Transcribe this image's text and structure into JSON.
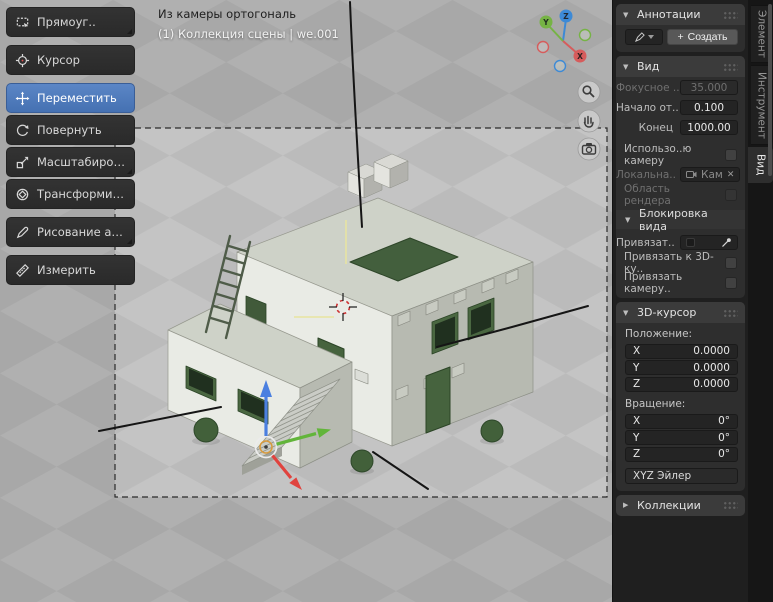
{
  "ui": {
    "tri_open": "▼",
    "tri_closed": "▶",
    "plus": "+",
    "clear": "✕"
  },
  "toolbar": {
    "tools": [
      {
        "label": "Прямоуг..",
        "active": false,
        "has_subtools": true
      },
      {
        "label": "Курсор",
        "active": false,
        "has_subtools": false
      },
      {
        "label": "Переместить",
        "active": true,
        "has_subtools": false
      },
      {
        "label": "Повернуть",
        "active": false,
        "has_subtools": false
      },
      {
        "label": "Масштабировать",
        "active": false,
        "has_subtools": true
      },
      {
        "label": "Трансформиров..",
        "active": false,
        "has_subtools": false
      },
      {
        "label": "Рисование анно..",
        "active": false,
        "has_subtools": true
      },
      {
        "label": "Измерить",
        "active": false,
        "has_subtools": false
      }
    ]
  },
  "viewport": {
    "view_label": "Из камеры ортогональ",
    "scene_label": "(1) Коллекция сцены | we.001",
    "axes": {
      "x": "X",
      "y": "Y",
      "z": "Z"
    }
  },
  "sidebar": {
    "annotations": {
      "title": "Аннотации",
      "create_label": "Создать"
    },
    "view": {
      "title": "Вид",
      "focal_label": "Фокусное ..",
      "focal_value": "35.000",
      "clip_start_label": "Начало от..",
      "clip_start_value": "0.100",
      "clip_end_label": "Конец",
      "clip_end_value": "1000.00",
      "use_local_camera_label": "Использо..ю камеру",
      "local_camera_label": "Локальна..",
      "local_camera_value": "Кам",
      "render_region_label": "Область рендера"
    },
    "view_lock": {
      "title": "Блокировка вида",
      "lock_object_label": "Привязат..",
      "lock_cursor_label": "Привязать к 3D-ку..",
      "lock_camera_label": "Привязать камеру.."
    },
    "cursor3d": {
      "title": "3D-курсор",
      "location_label": "Положение:",
      "loc": [
        {
          "axis": "X",
          "value": "0.0000"
        },
        {
          "axis": "Y",
          "value": "0.0000"
        },
        {
          "axis": "Z",
          "value": "0.0000"
        }
      ],
      "rotation_label": "Вращение:",
      "rot": [
        {
          "axis": "X",
          "value": "0°"
        },
        {
          "axis": "Y",
          "value": "0°"
        },
        {
          "axis": "Z",
          "value": "0°"
        }
      ],
      "rotation_mode": "XYZ Эйлер"
    },
    "collections": {
      "title": "Коллекции"
    },
    "tabs": [
      {
        "label": "Элемент",
        "active": false
      },
      {
        "label": "Инструмент",
        "active": false
      },
      {
        "label": "Вид",
        "active": true
      }
    ]
  },
  "colors": {
    "accent": "#4772b3",
    "axis_x": "#e0433e",
    "axis_y": "#62b53a",
    "axis_z": "#4a7fe0"
  }
}
